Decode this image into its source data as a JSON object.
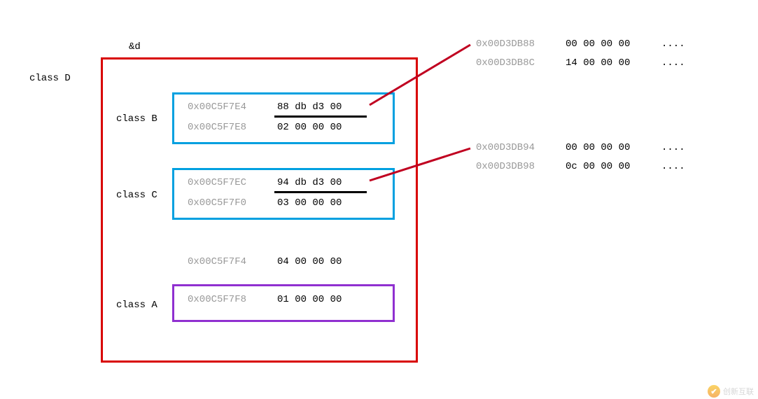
{
  "labels": {
    "amp_d": "&d",
    "class_d": "class D",
    "class_b": "class B",
    "class_c": "class C",
    "class_a": "class A"
  },
  "classB": {
    "addr1": "0x00C5F7E4",
    "bytes1": "88 db d3 00",
    "addr2": "0x00C5F7E8",
    "bytes2": "02 00 00 00"
  },
  "classC": {
    "addr1": "0x00C5F7EC",
    "bytes1": "94 db d3 00",
    "addr2": "0x00C5F7F0",
    "bytes2": "03 00 00 00"
  },
  "between": {
    "addr": "0x00C5F7F4",
    "bytes": "04 00 00 00"
  },
  "classA": {
    "addr": "0x00C5F7F8",
    "bytes": "01 00 00 00"
  },
  "vtableB": {
    "addr1": "0x00D3DB88",
    "bytes1": "00 00 00 00",
    "dots1": "....",
    "addr2": "0x00D3DB8C",
    "bytes2": "14 00 00 00",
    "dots2": "...."
  },
  "vtableC": {
    "addr1": "0x00D3DB94",
    "bytes1": "00 00 00 00",
    "dots1": "....",
    "addr2": "0x00D3DB98",
    "bytes2": "0c 00 00 00",
    "dots2": "...."
  },
  "watermark": "创新互联"
}
